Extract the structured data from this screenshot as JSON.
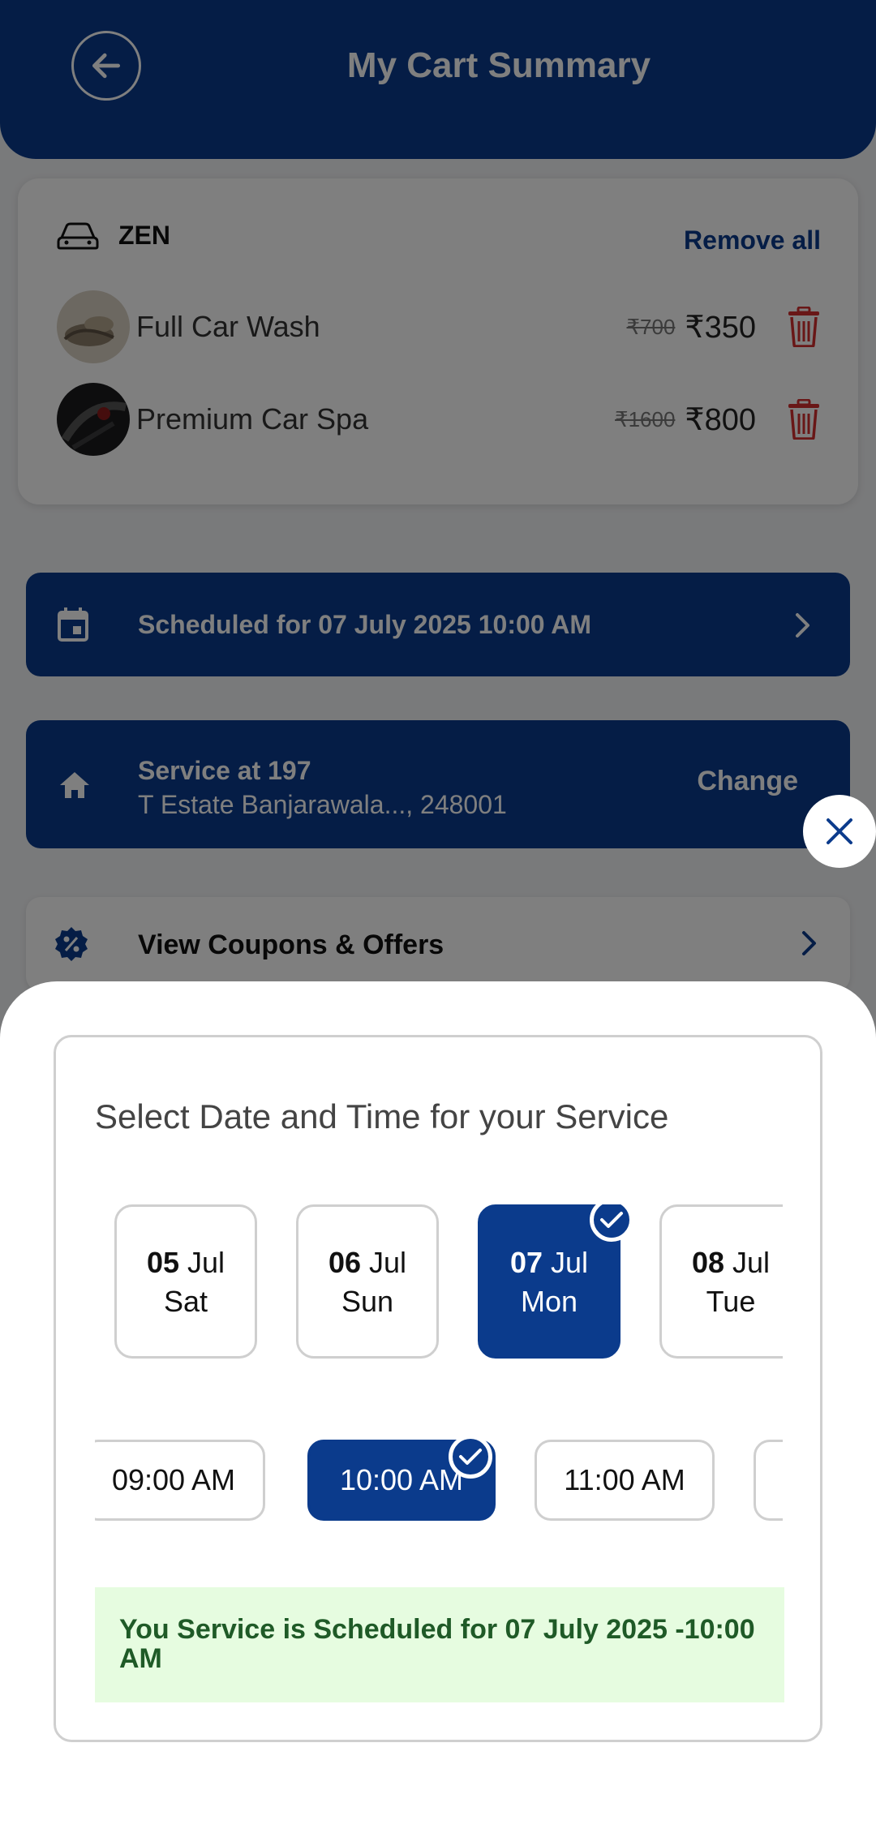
{
  "header": {
    "title": "My Cart Summary"
  },
  "cart": {
    "vehicle": "ZEN",
    "remove_all_label": "Remove all",
    "items": [
      {
        "name": "Full Car Wash",
        "old_price": "₹700",
        "price": "₹350"
      },
      {
        "name": "Premium Car Spa",
        "old_price": "₹1600",
        "price": "₹800"
      }
    ]
  },
  "schedule": {
    "text": "Scheduled for 07 July 2025 10:00 AM"
  },
  "address": {
    "line1": "Service at 197",
    "line2": "T Estate Banjarawala..., 248001",
    "change_label": "Change"
  },
  "coupons": {
    "label": "View Coupons & Offers"
  },
  "picker": {
    "title": "Select Date and Time for your Service",
    "dates": [
      {
        "day": "05",
        "month": "Jul",
        "weekday": "Sat",
        "selected": false
      },
      {
        "day": "06",
        "month": "Jul",
        "weekday": "Sun",
        "selected": false
      },
      {
        "day": "07",
        "month": "Jul",
        "weekday": "Mon",
        "selected": true
      },
      {
        "day": "08",
        "month": "Jul",
        "weekday": "Tue",
        "selected": false
      }
    ],
    "times": [
      {
        "label": "09:00 AM",
        "selected": false
      },
      {
        "label": "10:00 AM",
        "selected": true
      },
      {
        "label": "11:00 AM",
        "selected": false
      }
    ],
    "confirmation": "You Service is Scheduled for 07 July 2025 -10:00 AM"
  },
  "colors": {
    "primary": "#0b3b8c",
    "danger": "#d32f2f",
    "success_bg": "#e6fce0",
    "success_text": "#1f5a27"
  }
}
